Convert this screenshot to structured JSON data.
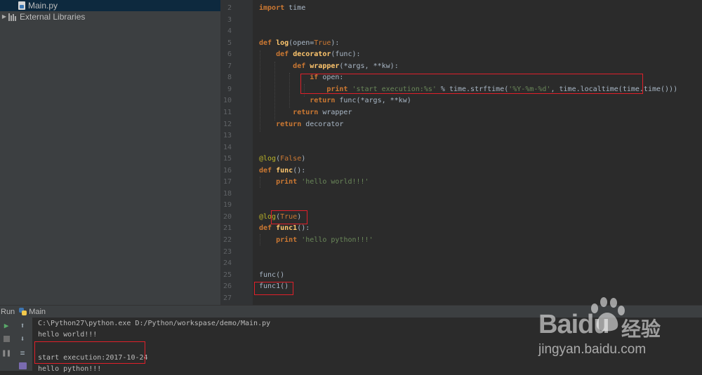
{
  "project_tree": {
    "items": [
      {
        "label": "Main.py",
        "icon": "python-file-icon"
      },
      {
        "label": "External Libraries",
        "icon": "library-icon"
      }
    ]
  },
  "editor": {
    "lines": [
      {
        "n": "2",
        "code": "import time"
      },
      {
        "n": "3",
        "code": ""
      },
      {
        "n": "4",
        "code": ""
      },
      {
        "n": "5",
        "code": "def log(open=True):"
      },
      {
        "n": "6",
        "code": "    def decorator(func):"
      },
      {
        "n": "7",
        "code": "        def wrapper(*args, **kw):"
      },
      {
        "n": "8",
        "code": "            if open:"
      },
      {
        "n": "9",
        "code": "                print 'start execution:%s' % time.strftime('%Y-%m-%d', time.localtime(time.time()))"
      },
      {
        "n": "10",
        "code": "            return func(*args, **kw)"
      },
      {
        "n": "11",
        "code": "        return wrapper"
      },
      {
        "n": "12",
        "code": "    return decorator"
      },
      {
        "n": "13",
        "code": ""
      },
      {
        "n": "14",
        "code": ""
      },
      {
        "n": "15",
        "code": "@log(False)"
      },
      {
        "n": "16",
        "code": "def func():"
      },
      {
        "n": "17",
        "code": "    print 'hello world!!!'"
      },
      {
        "n": "18",
        "code": ""
      },
      {
        "n": "19",
        "code": ""
      },
      {
        "n": "20",
        "code": "@log(True)"
      },
      {
        "n": "21",
        "code": "def func1():"
      },
      {
        "n": "22",
        "code": "    print 'hello python!!!'"
      },
      {
        "n": "23",
        "code": ""
      },
      {
        "n": "24",
        "code": ""
      },
      {
        "n": "25",
        "code": "func()"
      },
      {
        "n": "26",
        "code": "func1()"
      },
      {
        "n": "27",
        "code": ""
      }
    ]
  },
  "run_panel": {
    "tab_label": "Run",
    "config_name": "Main",
    "output": [
      "C:\\Python27\\python.exe D:/Python/workspase/demo/Main.py",
      "hello world!!!",
      "",
      "start execution:2017-10-24",
      "hello python!!!"
    ]
  },
  "watermark": {
    "brand": "Baidu",
    "cn": "经验",
    "url": "jingyan.baidu.com"
  },
  "colors": {
    "keyword": "#cc7832",
    "function": "#ffc66d",
    "string": "#6a8759",
    "decorator": "#bbb529",
    "highlight_box": "#e0202a"
  }
}
